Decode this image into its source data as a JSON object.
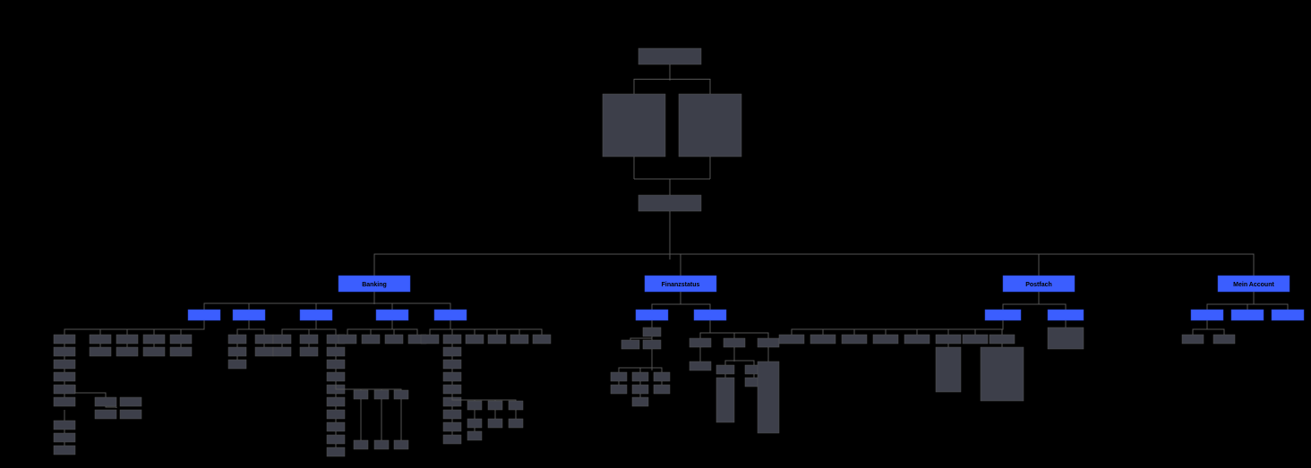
{
  "root": {
    "label": ""
  },
  "row2": [
    {
      "label": ""
    },
    {
      "label": ""
    }
  ],
  "row3": {
    "label": ""
  },
  "main_nav": [
    {
      "key": "banking",
      "label": "Banking"
    },
    {
      "key": "finanz",
      "label": "Finanzstatus"
    },
    {
      "key": "postfach",
      "label": "Postfach"
    },
    {
      "key": "account",
      "label": "Mein Account"
    }
  ],
  "banking_sub": [
    {
      "label": ""
    },
    {
      "label": ""
    },
    {
      "label": ""
    },
    {
      "label": ""
    },
    {
      "label": ""
    }
  ],
  "finanz_sub": [
    {
      "label": ""
    },
    {
      "label": ""
    }
  ],
  "postfach_sub": [
    {
      "label": ""
    },
    {
      "label": ""
    }
  ],
  "account_sub": [
    {
      "label": ""
    },
    {
      "label": ""
    },
    {
      "label": ""
    }
  ],
  "colors": {
    "bg": "#000",
    "node_grey": "#3d3f4a",
    "node_blue": "#3b5eff",
    "line": "#555"
  }
}
